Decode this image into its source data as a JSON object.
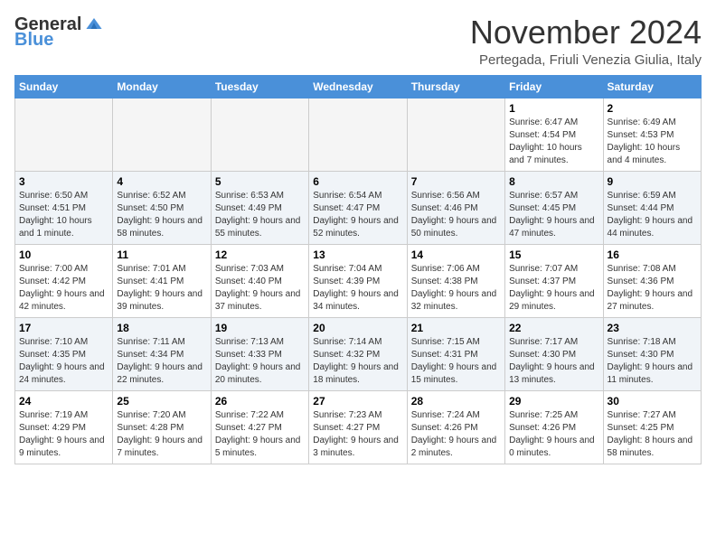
{
  "logo": {
    "general": "General",
    "blue": "Blue"
  },
  "title": "November 2024",
  "subtitle": "Pertegada, Friuli Venezia Giulia, Italy",
  "days_of_week": [
    "Sunday",
    "Monday",
    "Tuesday",
    "Wednesday",
    "Thursday",
    "Friday",
    "Saturday"
  ],
  "weeks": [
    [
      {
        "day": "",
        "info": ""
      },
      {
        "day": "",
        "info": ""
      },
      {
        "day": "",
        "info": ""
      },
      {
        "day": "",
        "info": ""
      },
      {
        "day": "",
        "info": ""
      },
      {
        "day": "1",
        "info": "Sunrise: 6:47 AM\nSunset: 4:54 PM\nDaylight: 10 hours and 7 minutes."
      },
      {
        "day": "2",
        "info": "Sunrise: 6:49 AM\nSunset: 4:53 PM\nDaylight: 10 hours and 4 minutes."
      }
    ],
    [
      {
        "day": "3",
        "info": "Sunrise: 6:50 AM\nSunset: 4:51 PM\nDaylight: 10 hours and 1 minute."
      },
      {
        "day": "4",
        "info": "Sunrise: 6:52 AM\nSunset: 4:50 PM\nDaylight: 9 hours and 58 minutes."
      },
      {
        "day": "5",
        "info": "Sunrise: 6:53 AM\nSunset: 4:49 PM\nDaylight: 9 hours and 55 minutes."
      },
      {
        "day": "6",
        "info": "Sunrise: 6:54 AM\nSunset: 4:47 PM\nDaylight: 9 hours and 52 minutes."
      },
      {
        "day": "7",
        "info": "Sunrise: 6:56 AM\nSunset: 4:46 PM\nDaylight: 9 hours and 50 minutes."
      },
      {
        "day": "8",
        "info": "Sunrise: 6:57 AM\nSunset: 4:45 PM\nDaylight: 9 hours and 47 minutes."
      },
      {
        "day": "9",
        "info": "Sunrise: 6:59 AM\nSunset: 4:44 PM\nDaylight: 9 hours and 44 minutes."
      }
    ],
    [
      {
        "day": "10",
        "info": "Sunrise: 7:00 AM\nSunset: 4:42 PM\nDaylight: 9 hours and 42 minutes."
      },
      {
        "day": "11",
        "info": "Sunrise: 7:01 AM\nSunset: 4:41 PM\nDaylight: 9 hours and 39 minutes."
      },
      {
        "day": "12",
        "info": "Sunrise: 7:03 AM\nSunset: 4:40 PM\nDaylight: 9 hours and 37 minutes."
      },
      {
        "day": "13",
        "info": "Sunrise: 7:04 AM\nSunset: 4:39 PM\nDaylight: 9 hours and 34 minutes."
      },
      {
        "day": "14",
        "info": "Sunrise: 7:06 AM\nSunset: 4:38 PM\nDaylight: 9 hours and 32 minutes."
      },
      {
        "day": "15",
        "info": "Sunrise: 7:07 AM\nSunset: 4:37 PM\nDaylight: 9 hours and 29 minutes."
      },
      {
        "day": "16",
        "info": "Sunrise: 7:08 AM\nSunset: 4:36 PM\nDaylight: 9 hours and 27 minutes."
      }
    ],
    [
      {
        "day": "17",
        "info": "Sunrise: 7:10 AM\nSunset: 4:35 PM\nDaylight: 9 hours and 24 minutes."
      },
      {
        "day": "18",
        "info": "Sunrise: 7:11 AM\nSunset: 4:34 PM\nDaylight: 9 hours and 22 minutes."
      },
      {
        "day": "19",
        "info": "Sunrise: 7:13 AM\nSunset: 4:33 PM\nDaylight: 9 hours and 20 minutes."
      },
      {
        "day": "20",
        "info": "Sunrise: 7:14 AM\nSunset: 4:32 PM\nDaylight: 9 hours and 18 minutes."
      },
      {
        "day": "21",
        "info": "Sunrise: 7:15 AM\nSunset: 4:31 PM\nDaylight: 9 hours and 15 minutes."
      },
      {
        "day": "22",
        "info": "Sunrise: 7:17 AM\nSunset: 4:30 PM\nDaylight: 9 hours and 13 minutes."
      },
      {
        "day": "23",
        "info": "Sunrise: 7:18 AM\nSunset: 4:30 PM\nDaylight: 9 hours and 11 minutes."
      }
    ],
    [
      {
        "day": "24",
        "info": "Sunrise: 7:19 AM\nSunset: 4:29 PM\nDaylight: 9 hours and 9 minutes."
      },
      {
        "day": "25",
        "info": "Sunrise: 7:20 AM\nSunset: 4:28 PM\nDaylight: 9 hours and 7 minutes."
      },
      {
        "day": "26",
        "info": "Sunrise: 7:22 AM\nSunset: 4:27 PM\nDaylight: 9 hours and 5 minutes."
      },
      {
        "day": "27",
        "info": "Sunrise: 7:23 AM\nSunset: 4:27 PM\nDaylight: 9 hours and 3 minutes."
      },
      {
        "day": "28",
        "info": "Sunrise: 7:24 AM\nSunset: 4:26 PM\nDaylight: 9 hours and 2 minutes."
      },
      {
        "day": "29",
        "info": "Sunrise: 7:25 AM\nSunset: 4:26 PM\nDaylight: 9 hours and 0 minutes."
      },
      {
        "day": "30",
        "info": "Sunrise: 7:27 AM\nSunset: 4:25 PM\nDaylight: 8 hours and 58 minutes."
      }
    ]
  ]
}
